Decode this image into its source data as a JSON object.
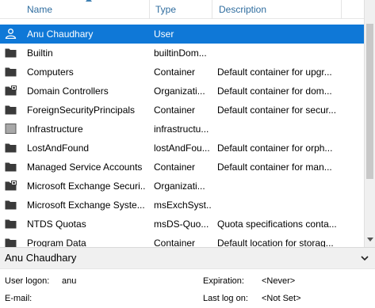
{
  "columns": {
    "name": "Name",
    "type": "Type",
    "description": "Description"
  },
  "rows": [
    {
      "name": "Anu Chaudhary",
      "type": "User",
      "description": "",
      "icon": "user-icon",
      "selected": true
    },
    {
      "name": "Builtin",
      "type": "builtinDom...",
      "description": "",
      "icon": "folder-icon"
    },
    {
      "name": "Computers",
      "type": "Container",
      "description": "Default container for upgr...",
      "icon": "folder-icon"
    },
    {
      "name": "Domain Controllers",
      "type": "Organizati...",
      "description": "Default container for dom...",
      "icon": "organizational-unit-icon"
    },
    {
      "name": "ForeignSecurityPrincipals",
      "type": "Container",
      "description": "Default container for secur...",
      "icon": "folder-icon"
    },
    {
      "name": "Infrastructure",
      "type": "infrastructu...",
      "description": "",
      "icon": "infrastructure-icon"
    },
    {
      "name": "LostAndFound",
      "type": "lostAndFou...",
      "description": "Default container for orph...",
      "icon": "folder-icon"
    },
    {
      "name": "Managed Service Accounts",
      "type": "Container",
      "description": "Default container for man...",
      "icon": "folder-icon"
    },
    {
      "name": "Microsoft Exchange Securi...",
      "type": "Organizati...",
      "description": "",
      "icon": "organizational-unit-icon"
    },
    {
      "name": "Microsoft Exchange Syste...",
      "type": "msExchSyst...",
      "description": "",
      "icon": "folder-icon"
    },
    {
      "name": "NTDS Quotas",
      "type": "msDS-Quo...",
      "description": "Quota specifications conta...",
      "icon": "folder-icon"
    },
    {
      "name": "Program Data",
      "type": "Container",
      "description": "Default location for storag...",
      "icon": "folder-icon"
    }
  ],
  "detail": {
    "title": "Anu Chaudhary",
    "user_logon_label": "User logon:",
    "user_logon_value": "anu",
    "email_label": "E-mail:",
    "email_value": "",
    "expiration_label": "Expiration:",
    "expiration_value": "<Never>",
    "last_logon_label": "Last log on:",
    "last_logon_value": "<Not Set>"
  },
  "colors": {
    "selection": "#0f78d7",
    "header_text": "#2f6d9f",
    "icon_dark": "#3a3a3a"
  }
}
